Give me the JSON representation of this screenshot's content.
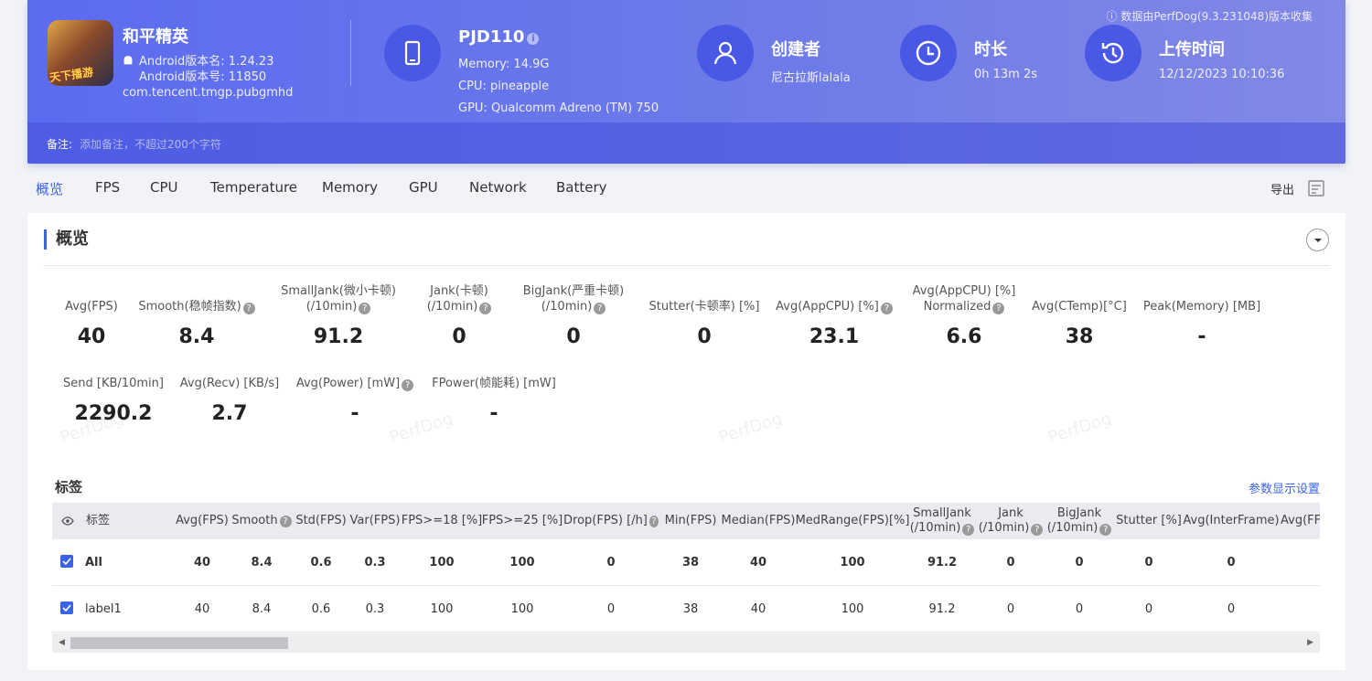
{
  "header": {
    "collect_note": "数据由PerfDog(9.3.231048)版本收集",
    "app": {
      "icon_caption": "天下播游",
      "name": "和平精英",
      "android_version_name": "Android版本名: 1.24.23",
      "android_version_code": "Android版本号: 11850",
      "package": "com.tencent.tmgp.pubgmhd"
    },
    "device": {
      "title": "PJD110",
      "memory": "Memory: 14.9G",
      "cpu": "CPU: pineapple",
      "gpu": "GPU: Qualcomm Adreno (TM) 750",
      "icon": "phone-icon"
    },
    "creator": {
      "title": "创建者",
      "value": "尼古拉斯lalala",
      "icon": "user-icon"
    },
    "duration": {
      "title": "时长",
      "value": "0h 13m 2s",
      "icon": "clock-icon"
    },
    "upload": {
      "title": "上传时间",
      "value": "12/12/2023 10:10:36",
      "icon": "history-icon"
    },
    "notes": {
      "label": "备注:",
      "placeholder": "添加备注，不超过200个字符"
    }
  },
  "tabs": {
    "items": [
      "概览",
      "FPS",
      "CPU",
      "Temperature",
      "Memory",
      "GPU",
      "Network",
      "Battery"
    ],
    "active": "概览",
    "export_label": "导出"
  },
  "overview": {
    "title": "概览",
    "metrics": [
      {
        "label": "Avg(FPS)",
        "value": "40"
      },
      {
        "label": "Smooth(稳帧指数)",
        "value": "8.4"
      },
      {
        "label": "SmallJank(微小卡顿)",
        "label2": "(/10min)",
        "value": "91.2"
      },
      {
        "label": "Jank(卡顿)",
        "label2": "(/10min)",
        "value": "0"
      },
      {
        "label": "BigJank(严重卡顿)",
        "label2": "(/10min)",
        "value": "0"
      },
      {
        "label": "Stutter(卡顿率) [%]",
        "value": "0"
      },
      {
        "label": "Avg(AppCPU) [%]",
        "value": "23.1"
      },
      {
        "label": "Avg(AppCPU) [%]",
        "label2": "Normalized",
        "value": "6.6"
      },
      {
        "label": "Avg(CTemp)[°C]",
        "value": "38"
      },
      {
        "label": "Peak(Memory) [MB]",
        "value": "-"
      },
      {
        "label": "Send [KB/10min]",
        "value": "2290.2"
      },
      {
        "label": "Avg(Recv) [KB/s]",
        "value": "2.7"
      },
      {
        "label": "Avg(Power) [mW]",
        "value": "-"
      },
      {
        "label": "FPower(帧能耗) [mW]",
        "value": "-"
      }
    ],
    "watermark": "PerfDog"
  },
  "tags": {
    "title": "标签",
    "settings_link": "参数显示设置",
    "columns": [
      "标签",
      "Avg(FPS)",
      "Smooth",
      "Std(FPS)",
      "Var(FPS)",
      "FPS>=18 [%]",
      "FPS>=25 [%]",
      "Drop(FPS) [/h]",
      "Min(FPS)",
      "Median(FPS)",
      "MedRange(FPS)[%]",
      "SmallJank",
      "Jank",
      "BigJank",
      "Stutter [%]",
      "Avg(InterFrame)",
      "Avg(FF"
    ],
    "columns_line2": {
      "SmallJank": "(/10min)",
      "Jank": "(/10min)",
      "BigJank": "(/10min)"
    },
    "rows": [
      {
        "name": "All",
        "values": [
          "40",
          "8.4",
          "0.6",
          "0.3",
          "100",
          "100",
          "0",
          "38",
          "40",
          "100",
          "91.2",
          "0",
          "0",
          "0",
          "0"
        ]
      },
      {
        "name": "label1",
        "values": [
          "40",
          "8.4",
          "0.6",
          "0.3",
          "100",
          "100",
          "0",
          "38",
          "40",
          "100",
          "91.2",
          "0",
          "0",
          "0",
          "0"
        ]
      }
    ]
  }
}
